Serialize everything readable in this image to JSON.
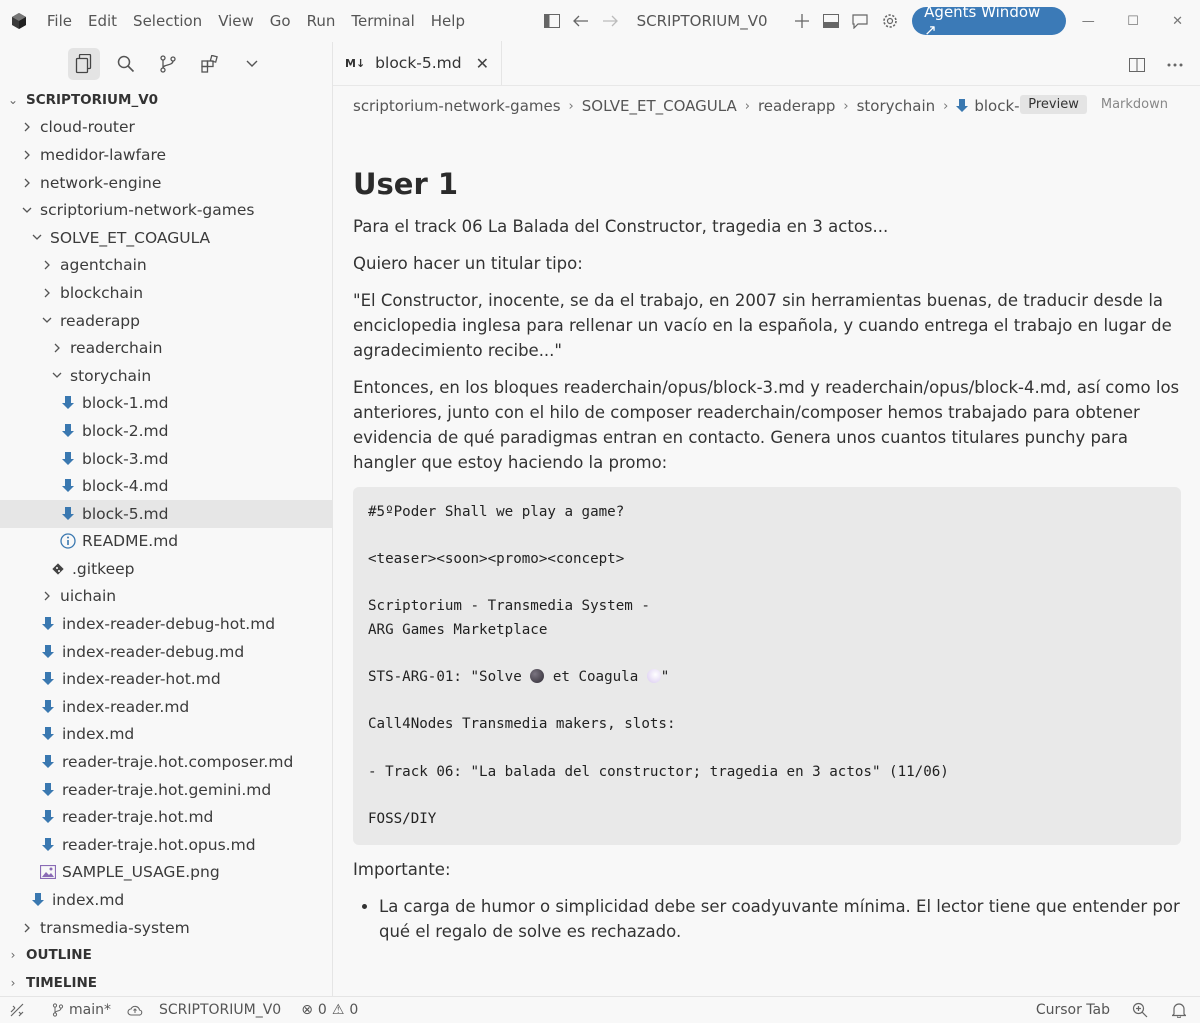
{
  "titlebar": {
    "menu": [
      "File",
      "Edit",
      "Selection",
      "View",
      "Go",
      "Run",
      "Terminal",
      "Help"
    ],
    "title": "SCRIPTORIUM_V0",
    "agents_button": "Agents Window ↗"
  },
  "sidebar": {
    "root_label": "SCRIPTORIUM_V0",
    "tree": [
      {
        "label": "cloud-router",
        "kind": "folder",
        "state": "collapsed",
        "depth": 1
      },
      {
        "label": "medidor-lawfare",
        "kind": "folder",
        "state": "collapsed",
        "depth": 1
      },
      {
        "label": "network-engine",
        "kind": "folder",
        "state": "collapsed",
        "depth": 1
      },
      {
        "label": "scriptorium-network-games",
        "kind": "folder",
        "state": "expanded",
        "depth": 1
      },
      {
        "label": "SOLVE_ET_COAGULA",
        "kind": "folder",
        "state": "expanded",
        "depth": 2
      },
      {
        "label": "agentchain",
        "kind": "folder",
        "state": "collapsed",
        "depth": 3
      },
      {
        "label": "blockchain",
        "kind": "folder",
        "state": "collapsed",
        "depth": 3
      },
      {
        "label": "readerapp",
        "kind": "folder",
        "state": "expanded",
        "depth": 3
      },
      {
        "label": "readerchain",
        "kind": "folder",
        "state": "collapsed",
        "depth": 4
      },
      {
        "label": "storychain",
        "kind": "folder",
        "state": "expanded",
        "depth": 4
      },
      {
        "label": "block-1.md",
        "kind": "md",
        "depth": 5
      },
      {
        "label": "block-2.md",
        "kind": "md",
        "depth": 5
      },
      {
        "label": "block-3.md",
        "kind": "md",
        "depth": 5
      },
      {
        "label": "block-4.md",
        "kind": "md",
        "depth": 5
      },
      {
        "label": "block-5.md",
        "kind": "md",
        "depth": 5,
        "selected": true
      },
      {
        "label": "README.md",
        "kind": "info",
        "depth": 5
      },
      {
        "label": ".gitkeep",
        "kind": "git",
        "depth": 4
      },
      {
        "label": "uichain",
        "kind": "folder",
        "state": "collapsed",
        "depth": 3
      },
      {
        "label": "index-reader-debug-hot.md",
        "kind": "md",
        "depth": 3
      },
      {
        "label": "index-reader-debug.md",
        "kind": "md",
        "depth": 3
      },
      {
        "label": "index-reader-hot.md",
        "kind": "md",
        "depth": 3
      },
      {
        "label": "index-reader.md",
        "kind": "md",
        "depth": 3
      },
      {
        "label": "index.md",
        "kind": "md",
        "depth": 3
      },
      {
        "label": "reader-traje.hot.composer.md",
        "kind": "md",
        "depth": 3
      },
      {
        "label": "reader-traje.hot.gemini.md",
        "kind": "md",
        "depth": 3
      },
      {
        "label": "reader-traje.hot.md",
        "kind": "md",
        "depth": 3
      },
      {
        "label": "reader-traje.hot.opus.md",
        "kind": "md",
        "depth": 3
      },
      {
        "label": "SAMPLE_USAGE.png",
        "kind": "image",
        "depth": 3
      },
      {
        "label": "index.md",
        "kind": "md",
        "depth": 2
      },
      {
        "label": "transmedia-system",
        "kind": "folder",
        "state": "collapsed",
        "depth": 1
      }
    ],
    "outline_label": "OUTLINE",
    "timeline_label": "TIMELINE"
  },
  "editor": {
    "tab_icon": "M↓",
    "tab_label": "block-5.md",
    "breadcrumbs": [
      "scriptorium-network-games",
      "SOLVE_ET_COAGULA",
      "readerapp",
      "storychain",
      "block-"
    ],
    "mode_preview": "Preview",
    "mode_markdown": "Markdown",
    "heading": "User 1",
    "p1": "Para el track 06 La Balada del Constructor, tragedia en 3 actos...",
    "p2": "Quiero hacer un titular tipo:",
    "p3": "\"El Constructor, inocente, se da el trabajo, en 2007 sin herramientas buenas, de traducir desde la enciclopedia inglesa para rellenar un vacío en la española, y cuando entrega el trabajo en lugar de agradecimiento recibe...\"",
    "p4": "Entonces, en los bloques readerchain/opus/block-3.md y readerchain/opus/block-4.md, así como los anteriores, junto con el hilo de composer readerchain/composer hemos trabajado para obtener evidencia de qué paradigmas entran en contacto. Genera unos cuantos titulares punchy para hangler que estoy haciendo la promo:",
    "code": {
      "line1": "#5ºPoder Shall we play a game?",
      "line2": "<teaser><soon><promo><concept>",
      "line3": "Scriptorium - Transmedia System -",
      "line4": "ARG Games Marketplace",
      "line5_a": "STS-ARG-01: \"Solve ",
      "line5_b": " et Coagula ",
      "line5_c": "\"",
      "line6": "Call4Nodes Transmedia makers, slots:",
      "line7": "- Track 06: \"La balada del constructor; tragedia en 3 actos\" (11/06)",
      "line8": "FOSS/DIY"
    },
    "important_label": "Importante:",
    "bullet1": "La carga de humor o simplicidad debe ser coadyuvante mínima. El lector tiene que entender por qué el regalo de solve es rechazado."
  },
  "statusbar": {
    "branch": "main*",
    "workspace": "SCRIPTORIUM_V0",
    "errors": "0",
    "warnings": "0",
    "cursor_tab": "Cursor Tab"
  },
  "colors": {
    "accent": "#3b7ab7",
    "md_icon": "#3a78b0",
    "info_icon": "#3a78b0",
    "selection": "#e6e6e6"
  }
}
